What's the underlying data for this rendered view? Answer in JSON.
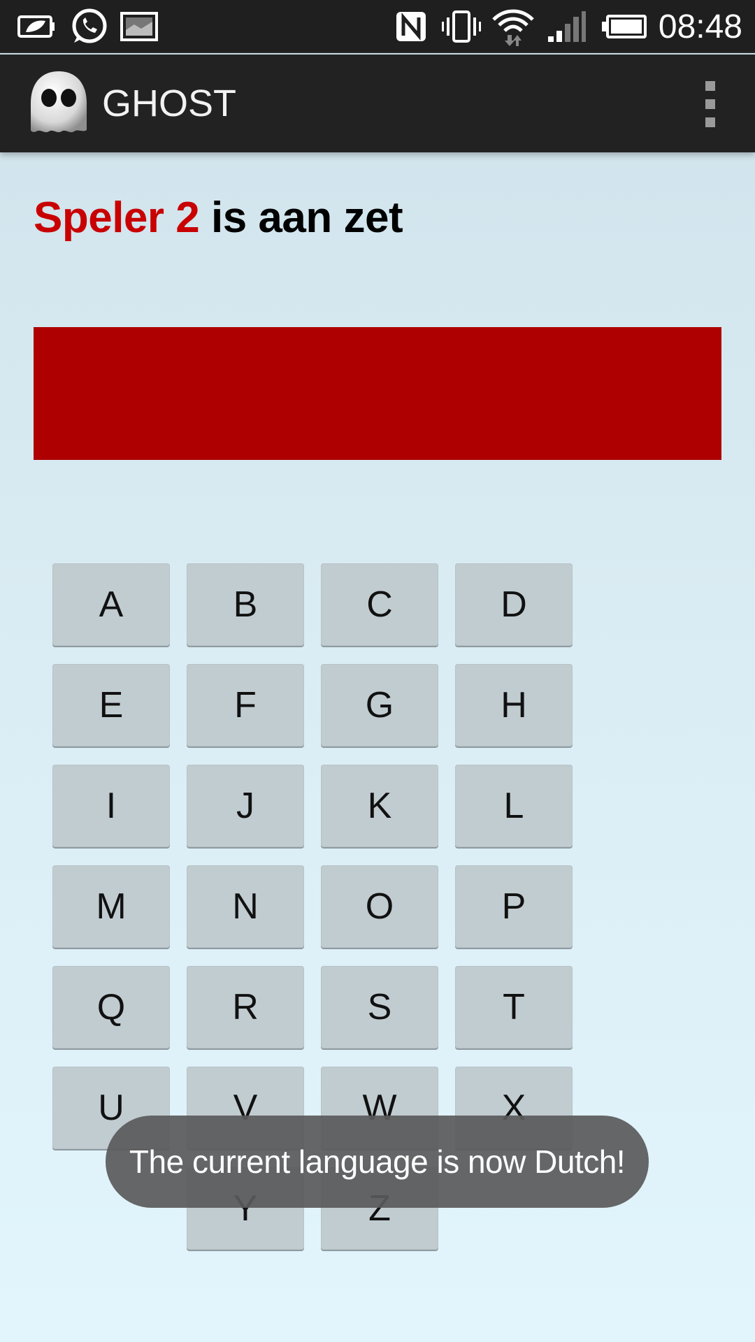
{
  "status_bar": {
    "time": "08:48",
    "icons": [
      "battery-saver-icon",
      "whatsapp-icon",
      "gallery-icon",
      "nfc-icon",
      "vibrate-icon",
      "wifi-icon",
      "signal-icon",
      "battery-icon"
    ]
  },
  "action_bar": {
    "title": "GHOST",
    "logo_icon": "ghost-logo-icon",
    "menu_icon": "overflow-menu-icon"
  },
  "game": {
    "turn_player": "Speler 2",
    "turn_suffix": " is aan zet",
    "current_word": "",
    "player_color": "#c80000",
    "word_box_color": "#ae0000"
  },
  "keyboard": {
    "keys": [
      "A",
      "B",
      "C",
      "D",
      "E",
      "F",
      "G",
      "H",
      "I",
      "J",
      "K",
      "L",
      "M",
      "N",
      "O",
      "P",
      "Q",
      "R",
      "S",
      "T",
      "U",
      "V",
      "W",
      "X",
      "Y",
      "Z"
    ]
  },
  "toast": {
    "message": "The current language is now Dutch!"
  }
}
